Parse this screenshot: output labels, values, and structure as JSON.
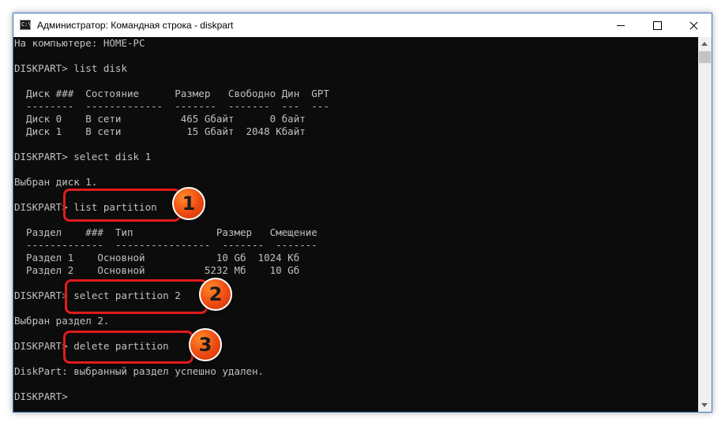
{
  "window": {
    "title": "Администратор: Командная строка - diskpart",
    "icon": "cmd-icon",
    "icon_text": "C:\\",
    "controls": [
      "minimize-icon",
      "maximize-icon",
      "close-icon"
    ]
  },
  "console": {
    "lines": [
      "На компьютере: HOME-PC",
      "",
      "DISKPART> list disk",
      "",
      "  Диск ###  Состояние      Размер   Свободно Дин  GPT",
      "  --------  -------------  -------  -------  ---  ---",
      "  Диск 0    В сети          465 Gбайт      0 байт",
      "  Диск 1    В сети           15 Gбайт  2048 Kбайт",
      "",
      "DISKPART> select disk 1",
      "",
      "Выбран диск 1.",
      "",
      "DISKPART> list partition",
      "",
      "  Раздел    ###  Тип              Размер   Смещение",
      "  -------------  ----------------  -------  -------",
      "  Раздел 1    Основной            10 Gб  1024 Kб",
      "  Раздел 2    Основной          5232 Mб    10 Gб",
      "",
      "DISKPART> select partition 2",
      "",
      "Выбран раздел 2.",
      "",
      "DISKPART> delete partition",
      "",
      "DiskPart: выбранный раздел успешно удален.",
      "",
      "DISKPART>"
    ]
  },
  "annotations": {
    "color": "#e21b1b",
    "badge_color": "#ee4a12",
    "badges": [
      "1",
      "2",
      "3"
    ]
  },
  "colors": {
    "console_bg": "#0c0c0c",
    "console_text": "#c0c0c0",
    "window_border": "#3b76c4"
  }
}
